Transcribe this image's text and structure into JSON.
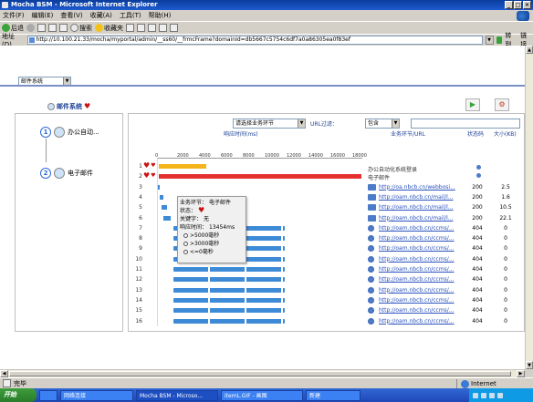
{
  "window": {
    "title": "Mocha BSM - Microsoft Internet Explorer"
  },
  "menu": [
    "文件(F)",
    "编辑(E)",
    "查看(V)",
    "收藏(A)",
    "工具(T)",
    "帮助(H)"
  ],
  "toolbar": {
    "back": "后退",
    "search": "搜索",
    "favorites": "收藏夹"
  },
  "address": {
    "label": "地址(D)",
    "url": "http://10.100.21.33/mocha/myportal/admin/__ss60/__frmcFrame?domainId=db5667c5754c6df7a0a86305ea0f83ef",
    "go": "转到",
    "links": "链接"
  },
  "app": {
    "system_select": "邮件系统",
    "system_title": "邮件系统",
    "play_icon": "▶",
    "settings_icon": "⚙",
    "filter_select": "请选择业务环节",
    "url_filter_label": "URL过滤：",
    "url_filter_select": "包含",
    "col_response": "响应时间(ms)",
    "col_url": "业务环节/URL",
    "col_state": "状态码",
    "col_size": "大小(KB)",
    "nodes": [
      {
        "label": "办公自动..."
      },
      {
        "label": "电子邮件"
      }
    ],
    "axis_ticks": [
      "0",
      "2000",
      "4000",
      "6000",
      "8000",
      "10000",
      "12000",
      "14000",
      "16000",
      "18000"
    ],
    "info_lines": [
      "办公自动化系统登录",
      "电子邮件"
    ],
    "rows": [
      {
        "num": "1",
        "hearts": 2,
        "bar": "orange",
        "url": "",
        "state": "",
        "size": ""
      },
      {
        "num": "2",
        "hearts": 2,
        "bar": "red",
        "url": "",
        "state": "",
        "size": ""
      },
      {
        "num": "3",
        "hearts": 0,
        "bar": "dot",
        "url": "http://oa.nbcb.cn/webbosi...",
        "state": "200",
        "size": "2.5"
      },
      {
        "num": "4",
        "hearts": 0,
        "bar": "dot",
        "url": "http://oam.nbcb.cn/mail/l...",
        "state": "200",
        "size": "1.6"
      },
      {
        "num": "5",
        "hearts": 0,
        "bar": "dot",
        "url": "http://oam.nbcb.cn/mail/l...",
        "state": "200",
        "size": "10.5"
      },
      {
        "num": "6",
        "hearts": 0,
        "bar": "dot",
        "url": "http://oam.nbcb.cn/mail/l...",
        "state": "200",
        "size": "22.1"
      },
      {
        "num": "7",
        "hearts": 0,
        "bar": "blue",
        "url": "http://oam.nbcb.cn/ccms/...",
        "state": "404",
        "size": "0"
      },
      {
        "num": "8",
        "hearts": 0,
        "bar": "blue",
        "url": "http://oam.nbcb.cn/ccms/...",
        "state": "404",
        "size": "0"
      },
      {
        "num": "9",
        "hearts": 0,
        "bar": "blue",
        "url": "http://oam.nbcb.cn/ccms/...",
        "state": "404",
        "size": "0"
      },
      {
        "num": "10",
        "hearts": 0,
        "bar": "blue",
        "url": "http://oam.nbcb.cn/ccms/...",
        "state": "404",
        "size": "0"
      },
      {
        "num": "11",
        "hearts": 0,
        "bar": "blue",
        "url": "http://oam.nbcb.cn/ccms/...",
        "state": "404",
        "size": "0"
      },
      {
        "num": "12",
        "hearts": 0,
        "bar": "blue",
        "url": "http://oam.nbcb.cn/ccms/...",
        "state": "404",
        "size": "0"
      },
      {
        "num": "13",
        "hearts": 0,
        "bar": "blue",
        "url": "http://oam.nbcb.cn/ccms/...",
        "state": "404",
        "size": "0"
      },
      {
        "num": "14",
        "hearts": 0,
        "bar": "blue",
        "url": "http://oam.nbcb.cn/ccms/...",
        "state": "404",
        "size": "0"
      },
      {
        "num": "15",
        "hearts": 0,
        "bar": "blue",
        "url": "http://oam.nbcb.cn/ccms/...",
        "state": "404",
        "size": "0"
      },
      {
        "num": "16",
        "hearts": 0,
        "bar": "blue",
        "url": "http://oam.nbcb.cn/ccms/...",
        "state": "404",
        "size": "0"
      }
    ],
    "tooltip": {
      "step_label": "业务环节：",
      "step_value": "电子邮件",
      "status_label": "状态：",
      "keyword_label": "关键字：",
      "keyword_value": "无",
      "response_label": "响应时间：",
      "response_value": "13454ms",
      "opt1": ">5000毫秒",
      "opt2": ">3000毫秒",
      "opt3": "<=0毫秒"
    }
  },
  "status": {
    "left": "完毕",
    "zone": "Internet"
  },
  "taskbar": {
    "start": "开始",
    "items": [
      "网络连接",
      "Mocha BSM - Microso...",
      "itemL.GIF - 画图",
      "新建"
    ]
  },
  "colors": {
    "orange": "#f3b51a",
    "red": "#e53030",
    "blue": "#3d8ad6",
    "accent": "#1c3f96"
  }
}
